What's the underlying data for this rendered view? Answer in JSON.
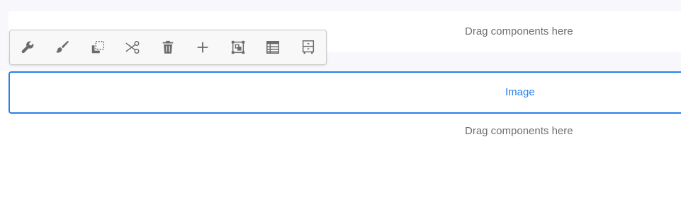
{
  "dropzone_top": {
    "text": "Drag components here"
  },
  "image_component": {
    "label": "Image"
  },
  "dropzone_bottom": {
    "text": "Drag components here"
  },
  "toolbar": {
    "items": [
      {
        "icon": "wrench-icon",
        "action": "configure"
      },
      {
        "icon": "brush-icon",
        "action": "style"
      },
      {
        "icon": "copy-icon",
        "action": "copy"
      },
      {
        "icon": "scissors-icon",
        "action": "cut"
      },
      {
        "icon": "trash-icon",
        "action": "delete"
      },
      {
        "icon": "plus-icon",
        "action": "insert"
      },
      {
        "icon": "group-icon",
        "action": "group"
      },
      {
        "icon": "layout-icon",
        "action": "layout"
      },
      {
        "icon": "container-icon",
        "action": "parent"
      }
    ]
  },
  "colors": {
    "accent": "#2680eb",
    "icon": "#6b6b6b",
    "text_muted": "#6e6e6e",
    "band": "#f7f7fc"
  }
}
